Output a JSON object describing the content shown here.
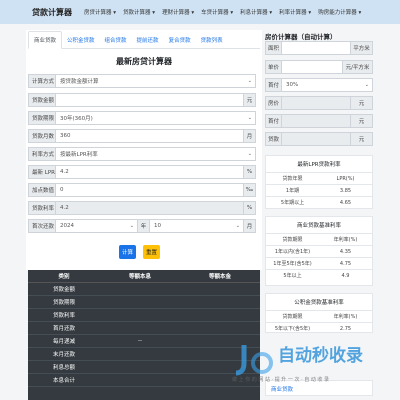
{
  "nav": {
    "brand": "贷款计算器",
    "items": [
      "房贷计算器",
      "贷款计算器",
      "理财计算器",
      "车贷计算器",
      "利息计算器",
      "利率计算器",
      "购房能力计算器"
    ]
  },
  "tabs": [
    "商业贷款",
    "公积金贷款",
    "组合贷款",
    "提前还款",
    "复合贷款",
    "贷款列表"
  ],
  "form": {
    "title": "最新房贷计算器",
    "method_label": "计算方式",
    "method_value": "按贷款金额计算",
    "amount_label": "贷款金额",
    "amount_unit": "元",
    "term_label": "贷款期限",
    "term_value": "30年(360月)",
    "months_label": "贷款月数",
    "months_value": "360",
    "months_unit": "月",
    "ratetype_label": "利率方式",
    "ratetype_value": "按最新LPR利率",
    "lpr_label": "最新 LPR",
    "lpr_value": "4.2",
    "lpr_unit": "%",
    "bp_label": "加点数值",
    "bp_value": "0",
    "bp_unit": "‰",
    "rate_label": "贷款利率",
    "rate_value": "4.2",
    "rate_unit": "%",
    "first_label": "首次还款",
    "first_year": "2024",
    "year_unit": "年",
    "first_month": "10",
    "month_unit": "月",
    "calc_button": "计算",
    "reset_button": "重置"
  },
  "results": {
    "headers": [
      "类别",
      "等额本息",
      "等额本金"
    ],
    "rows": [
      "贷款金额",
      "贷款期限",
      "贷款利率",
      "首月还款",
      "每月递减",
      "末月还款",
      "利息总额",
      "本息合计"
    ],
    "decrease_value": "--"
  },
  "right": {
    "title": "房价计算器（自动计算）",
    "area_label": "面积",
    "area_unit": "平方米",
    "price_label": "单价",
    "price_unit": "元/平方米",
    "ratio_label": "首付",
    "ratio_value": "30%",
    "house_label": "房价",
    "house_unit": "元",
    "down_label": "首付",
    "down_unit": "元",
    "loan_label": "贷款",
    "loan_unit": "元"
  },
  "lpr_table": {
    "title": "最新LPR贷款利率",
    "headers": [
      "贷款年限",
      "LPR(%)"
    ],
    "rows": [
      [
        "1年期",
        "3.85"
      ],
      [
        "5年期以上",
        "4.65"
      ]
    ]
  },
  "base_table": {
    "title": "商业贷款基准利率",
    "headers": [
      "贷款期限",
      "年利率(%)"
    ],
    "rows": [
      [
        "1年以内(含1年)",
        "4.35"
      ],
      [
        "1年至5年(含5年)",
        "4.75"
      ],
      [
        "5年以上",
        "4.9"
      ]
    ]
  },
  "fund_table": {
    "title": "公积金贷款基准利率",
    "headers": [
      "贷款期限",
      "年利率(%)"
    ],
    "rows": [
      [
        "5年以下(含5年)",
        "2.75"
      ]
    ]
  },
  "bottom_link": "商业贷款",
  "watermark": {
    "title": "自动秒收录",
    "sub": "做 上 你 的 网 站 · 提 升 一 次 · 自 动 收 录"
  }
}
